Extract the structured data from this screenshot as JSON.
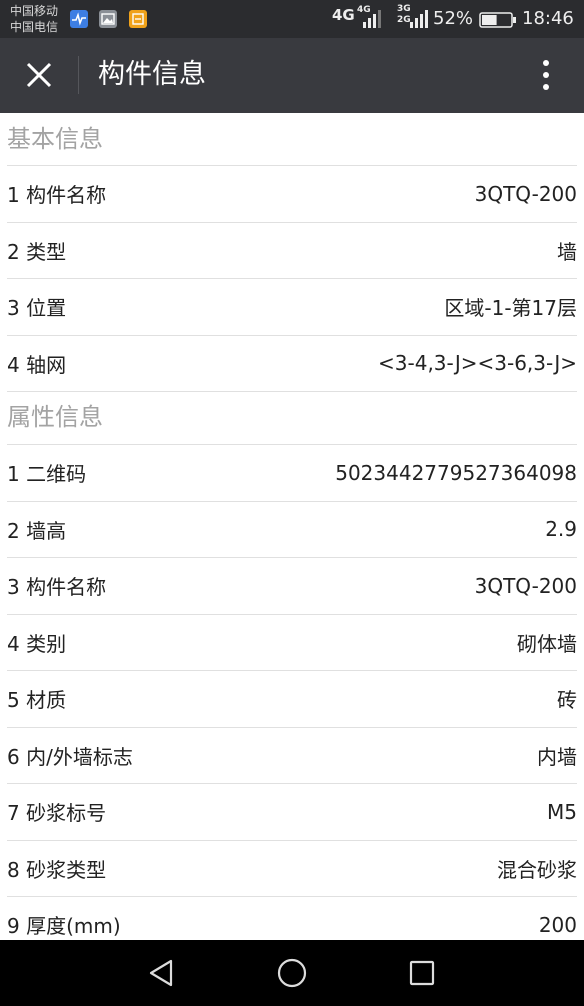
{
  "status_bar": {
    "carrier_1": "中国移动",
    "carrier_2": "中国电信",
    "network_1": "4G",
    "network_2": "4G",
    "network_3a": "3G",
    "network_3b": "2G",
    "battery_percent": "52%",
    "battery_level": 0.52,
    "time": "18:46"
  },
  "header": {
    "title": "构件信息",
    "close_icon": "close-icon",
    "more_icon": "more-vertical-icon"
  },
  "sections": {
    "basic": {
      "title": "基本信息",
      "rows": [
        {
          "label": "1 构件名称",
          "value": "3QTQ-200"
        },
        {
          "label": "2 类型",
          "value": "墙"
        },
        {
          "label": "3 位置",
          "value": "区域-1-第17层"
        },
        {
          "label": "4 轴网",
          "value": "<3-4,3-J><3-6,3-J>"
        }
      ]
    },
    "properties": {
      "title": "属性信息",
      "rows": [
        {
          "label": "1 二维码",
          "value": "5023442779527364098"
        },
        {
          "label": "2 墙高",
          "value": "2.9"
        },
        {
          "label": "3 构件名称",
          "value": "3QTQ-200"
        },
        {
          "label": "4 类别",
          "value": "砌体墙"
        },
        {
          "label": "5 材质",
          "value": "砖"
        },
        {
          "label": "6 内/外墙标志",
          "value": "内墙"
        },
        {
          "label": "7 砂浆标号",
          "value": "M5"
        },
        {
          "label": "8 砂浆类型",
          "value": "混合砂浆"
        },
        {
          "label": "9 厚度(mm)",
          "value": "200"
        }
      ]
    }
  },
  "nav": {
    "back_icon": "back-triangle-icon",
    "home_icon": "home-circle-icon",
    "recent_icon": "recent-square-icon"
  },
  "colors": {
    "status_bar_bg": "#2b2c2f",
    "header_bg": "#393a3f",
    "section_title": "#a3a3a3",
    "text": "#222222",
    "divider": "#e0e0e0"
  }
}
